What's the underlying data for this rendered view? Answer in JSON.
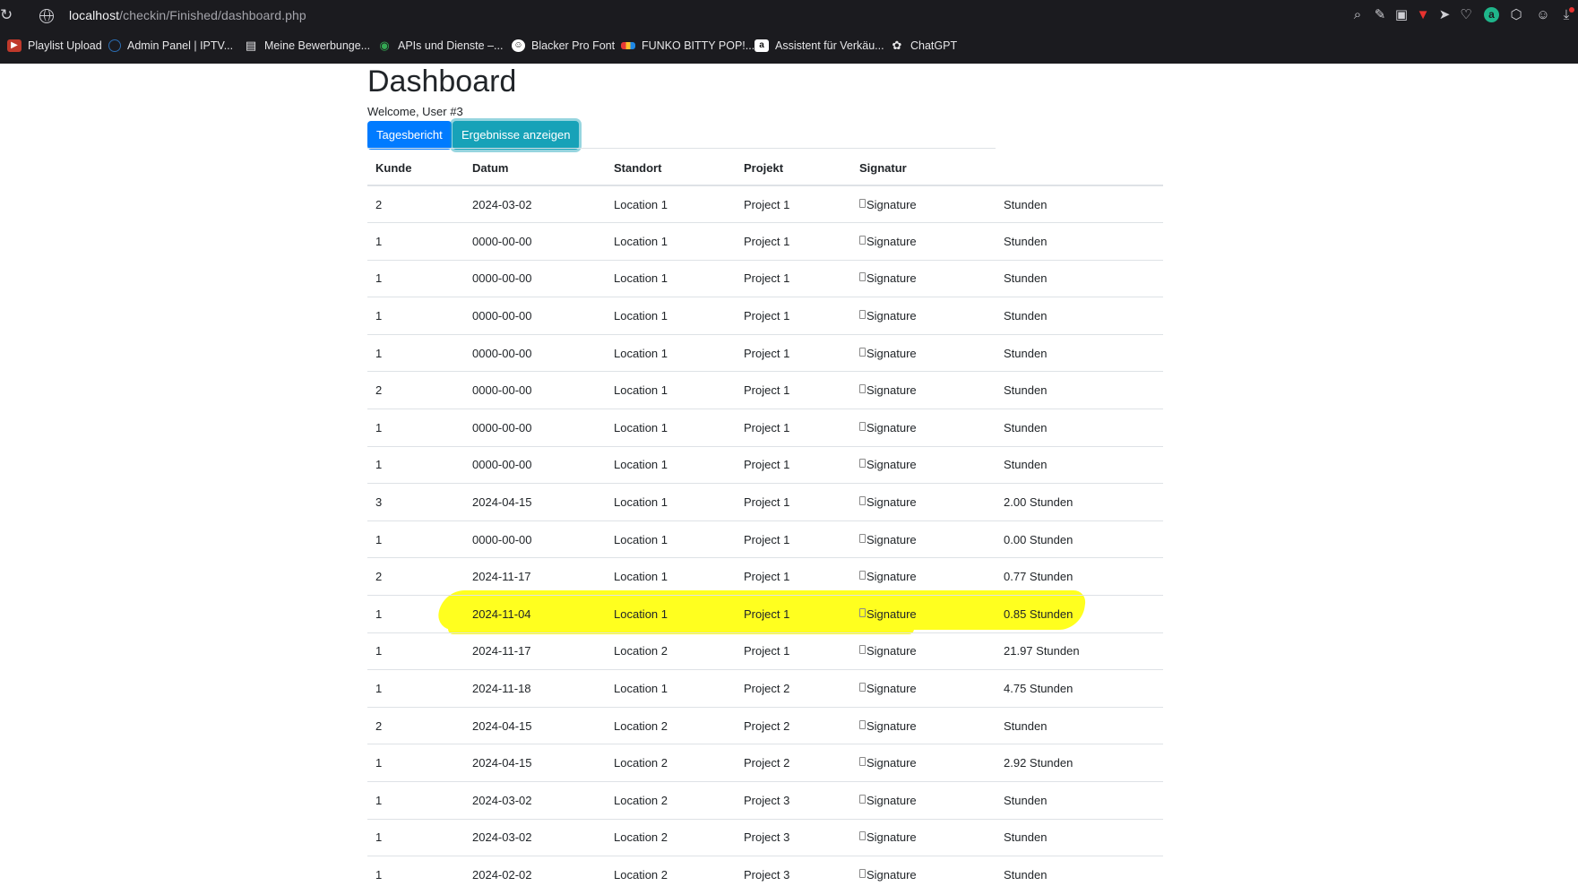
{
  "browser": {
    "url_host": "localhost",
    "url_path": "/checkin/Finished/dashboard.php",
    "bookmarks": [
      {
        "label": "Playlist Upload",
        "icon": "playlist-icon",
        "color": "#c0392b"
      },
      {
        "label": "Admin Panel | IPTV...",
        "icon": "circle-logo-icon",
        "color": "#2b6cb0"
      },
      {
        "label": "Meine Bewerbunge...",
        "icon": "document-icon",
        "color": "#e6e6e8"
      },
      {
        "label": "APIs und Dienste –...",
        "icon": "map-pin-icon",
        "color": "#34a853"
      },
      {
        "label": "Blacker Pro Font",
        "icon": "smiley-icon",
        "color": "#ffffff"
      },
      {
        "label": "FUNKO BITTY POP!...",
        "icon": "color-bars-icon",
        "color": "#f4b400"
      },
      {
        "label": "Assistent für Verkäu...",
        "icon": "amazon-icon",
        "color": "#ffffff"
      },
      {
        "label": "ChatGPT",
        "icon": "chatgpt-icon",
        "color": "#e6e6e8"
      }
    ],
    "ext_letter": "a"
  },
  "page": {
    "title": "Dashboard",
    "welcome": "Welcome, User #3",
    "btn_report": "Tagesbericht",
    "btn_results": "Ergebnisse anzeigen"
  },
  "table": {
    "headers": [
      "Kunde",
      "Datum",
      "Standort",
      "Projekt",
      "Signatur",
      ""
    ],
    "signature_alt": "Signature",
    "rows": [
      [
        "2",
        "2024-03-02",
        "Location 1",
        "Project 1",
        "Stunden"
      ],
      [
        "1",
        "0000-00-00",
        "Location 1",
        "Project 1",
        "Stunden"
      ],
      [
        "1",
        "0000-00-00",
        "Location 1",
        "Project 1",
        "Stunden"
      ],
      [
        "1",
        "0000-00-00",
        "Location 1",
        "Project 1",
        "Stunden"
      ],
      [
        "1",
        "0000-00-00",
        "Location 1",
        "Project 1",
        "Stunden"
      ],
      [
        "2",
        "0000-00-00",
        "Location 1",
        "Project 1",
        "Stunden"
      ],
      [
        "1",
        "0000-00-00",
        "Location 1",
        "Project 1",
        "Stunden"
      ],
      [
        "1",
        "0000-00-00",
        "Location 1",
        "Project 1",
        "Stunden"
      ],
      [
        "3",
        "2024-04-15",
        "Location 1",
        "Project 1",
        "2.00 Stunden"
      ],
      [
        "1",
        "0000-00-00",
        "Location 1",
        "Project 1",
        "0.00 Stunden"
      ],
      [
        "2",
        "2024-11-17",
        "Location 1",
        "Project 1",
        "0.77 Stunden"
      ],
      [
        "1",
        "2024-11-04",
        "Location 1",
        "Project 1",
        "0.85 Stunden"
      ],
      [
        "1",
        "2024-11-17",
        "Location 2",
        "Project 1",
        "21.97 Stunden"
      ],
      [
        "1",
        "2024-11-18",
        "Location 1",
        "Project 2",
        "4.75 Stunden"
      ],
      [
        "2",
        "2024-04-15",
        "Location 2",
        "Project 2",
        "Stunden"
      ],
      [
        "1",
        "2024-04-15",
        "Location 2",
        "Project 2",
        "2.92 Stunden"
      ],
      [
        "1",
        "2024-03-02",
        "Location 2",
        "Project 3",
        "Stunden"
      ],
      [
        "1",
        "2024-03-02",
        "Location 2",
        "Project 3",
        "Stunden"
      ],
      [
        "1",
        "2024-02-02",
        "Location 2",
        "Project 3",
        "Stunden"
      ]
    ],
    "highlight_color": "#ffff1f"
  }
}
